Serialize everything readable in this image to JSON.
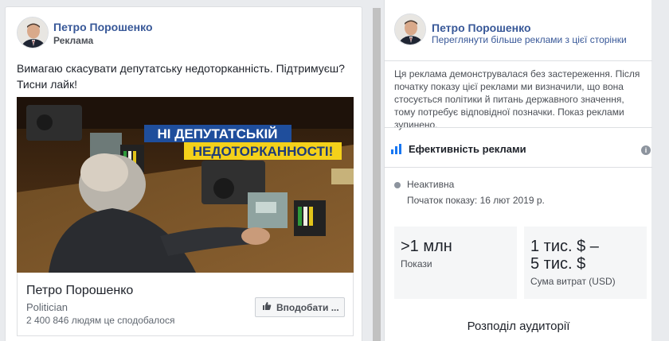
{
  "ad": {
    "page_name": "Петро Порошенко",
    "sponsored_label": "Реклама",
    "text_line1": "Вимагаю скасувати депутатську недоторканність. Підтримуєш?",
    "text_line2": "Тисни лайк!",
    "banner_line1": "НІ ДЕПУТАТСЬКІЙ",
    "banner_line2": "НЕДОТОРКАННОСТІ!",
    "footer": {
      "page_name": "Петро Порошенко",
      "category": "Politician",
      "likes": "2 400 846 людям це сподобалося",
      "like_button_label": "Вподобати ..."
    }
  },
  "panel": {
    "page_name": "Петро Порошенко",
    "see_more_link": "Переглянути більше реклами з цієї сторінки",
    "notice": "Ця реклама демонструвалася без застереження. Після початку показу цієї реклами ми визначили, що вона стосується політики й питань державного значення, тому потребує відповідної позначки. Показ реклами зупинено.",
    "performance_title": "Ефективність реклами",
    "status": "Неактивна",
    "start_date": "Початок показу: 16 лют 2019 р.",
    "impressions_value": ">1 млн",
    "impressions_label": "Покази",
    "spend_value_line1": "1 тис. $ –",
    "spend_value_line2": "5 тис. $",
    "spend_label": "Сума витрат (USD)",
    "audience_title": "Розподіл аудиторії"
  },
  "colors": {
    "link_blue": "#385898",
    "banner_blue": "#1f4e9c",
    "banner_yellow": "#f4d11a",
    "panel_bg": "#ffffff",
    "page_bg": "#e9ebee"
  },
  "icons": [
    "avatar",
    "chart-icon",
    "info-icon",
    "thumbs-up-icon",
    "status-dot"
  ]
}
